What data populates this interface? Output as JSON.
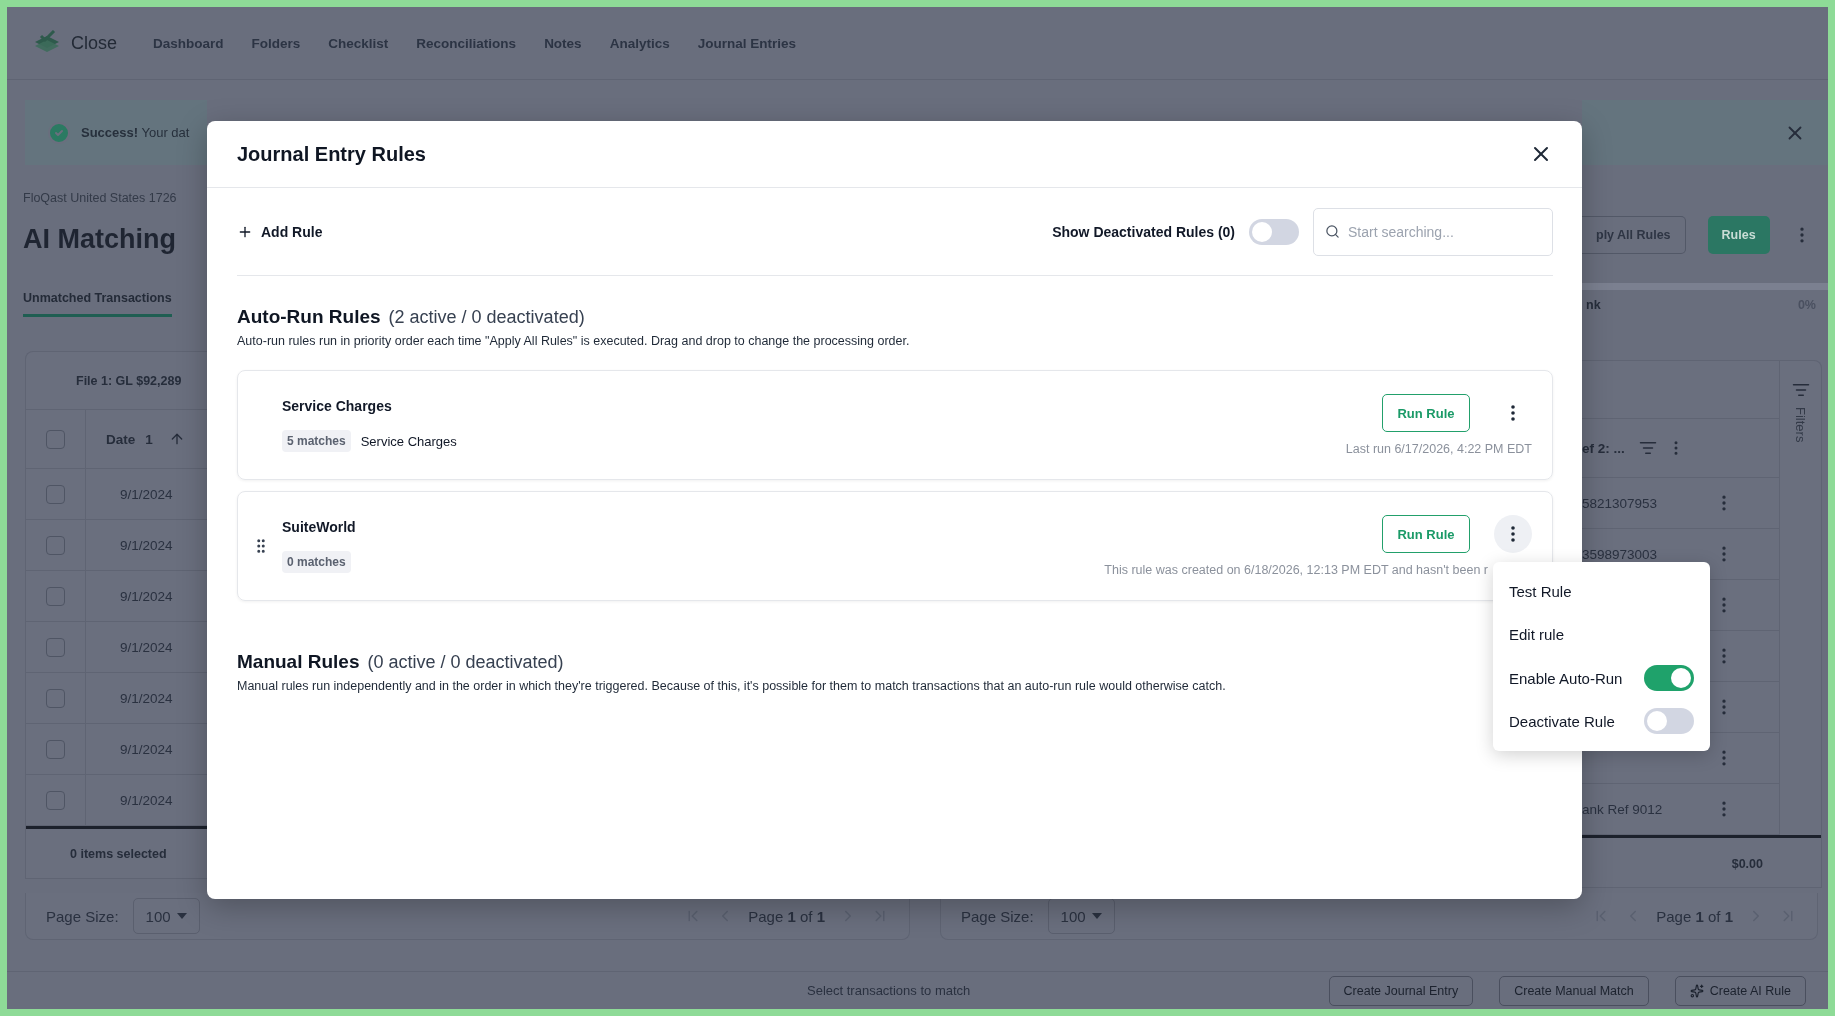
{
  "app": {
    "name": "Close",
    "nav": [
      {
        "label": "Dashboard"
      },
      {
        "label": "Folders"
      },
      {
        "label": "Checklist"
      },
      {
        "label": "Reconciliations"
      },
      {
        "label": "Notes"
      },
      {
        "label": "Analytics"
      },
      {
        "label": "Journal Entries"
      }
    ]
  },
  "banner": {
    "text": "**Success!** Your dat"
  },
  "page": {
    "breadcrumb": "FloQast United States 1726",
    "title": "AI Matching",
    "tabs": [
      {
        "label": "Unmatched Transactions",
        "selected": true
      }
    ],
    "actions": [
      {
        "label": "ply All Rules",
        "kind": "outline"
      },
      {
        "label": "Rules",
        "kind": "primary"
      }
    ],
    "progress": {
      "label": "nk",
      "reading": "0%"
    }
  },
  "left_table": {
    "file_label": "File 1: GL $92,289",
    "all_checked": false,
    "column": "Date",
    "sort_index": "1",
    "rows": [
      {
        "date": "9/1/2024",
        "checked": false
      },
      {
        "date": "9/1/2024",
        "checked": false
      },
      {
        "date": "9/1/2024",
        "checked": false
      },
      {
        "date": "9/1/2024",
        "checked": false
      },
      {
        "date": "9/1/2024",
        "checked": false
      },
      {
        "date": "9/1/2024",
        "checked": false
      },
      {
        "date": "9/1/2024",
        "checked": false
      }
    ],
    "footer": "0 items selected",
    "pager": {
      "page_size_label": "Page Size:",
      "page_size": "100",
      "page": "Page **1** of **1**"
    }
  },
  "right_table": {
    "column": "ef 2: ...",
    "filters_label": "Filters",
    "rows": [
      {
        "ref": "5821307953"
      },
      {
        "ref": "3598973003"
      },
      {},
      {},
      {},
      {},
      {
        "ref": "ank Ref 9012"
      }
    ],
    "footer": "$0.00",
    "pager": {
      "page_size_label": "Page Size:",
      "page_size": "100",
      "page": "Page **1** of **1**"
    }
  },
  "action_bar": {
    "hint": "Select transactions to match",
    "buttons": [
      {
        "label": "Create Journal Entry",
        "kind": "plain"
      },
      {
        "label": "Create Manual Match",
        "kind": "plain"
      },
      {
        "label": "Create AI Rule",
        "kind": "ai"
      }
    ]
  },
  "modal": {
    "title": "Journal Entry Rules",
    "add_label": "Add Rule",
    "show_deactivated": {
      "label": "Show Deactivated Rules (0)",
      "on": false
    },
    "search": {
      "placeholder": "Start searching..."
    },
    "sections": [
      {
        "title": "Auto-Run Rules",
        "count": "(2 active / 0 deactivated)",
        "description": "Auto-run rules run in priority order each time \"Apply All Rules\" is executed. Drag and drop to change the processing order.",
        "rules": [
          {
            "name": "Service Charges",
            "matches": "5 matches",
            "tags": [
              "Service Charges"
            ],
            "run_label": "Run Rule",
            "meta": "Last run 6/17/2026, 4:22 PM EDT",
            "menu_open": false
          },
          {
            "name": "SuiteWorld",
            "matches": "0 matches",
            "run_label": "Run Rule",
            "meta": "This rule was created on 6/18/2026, 12:13 PM EDT and hasn't been r",
            "menu_open": true
          }
        ]
      },
      {
        "title": "Manual Rules",
        "count": "(0 active / 0 deactivated)",
        "description": "Manual rules run independently and in the order in which they're triggered. Because of this, it's possible for them to match transactions that an auto-run rule would otherwise catch."
      }
    ],
    "menu": {
      "items": [
        {
          "label": "Test Rule",
          "kind": "action"
        },
        {
          "label": "Edit rule",
          "kind": "action"
        },
        {
          "label": "Enable Auto-Run",
          "kind": "toggle",
          "on": true
        },
        {
          "label": "Deactivate Rule",
          "kind": "toggle",
          "on": false
        }
      ]
    }
  }
}
